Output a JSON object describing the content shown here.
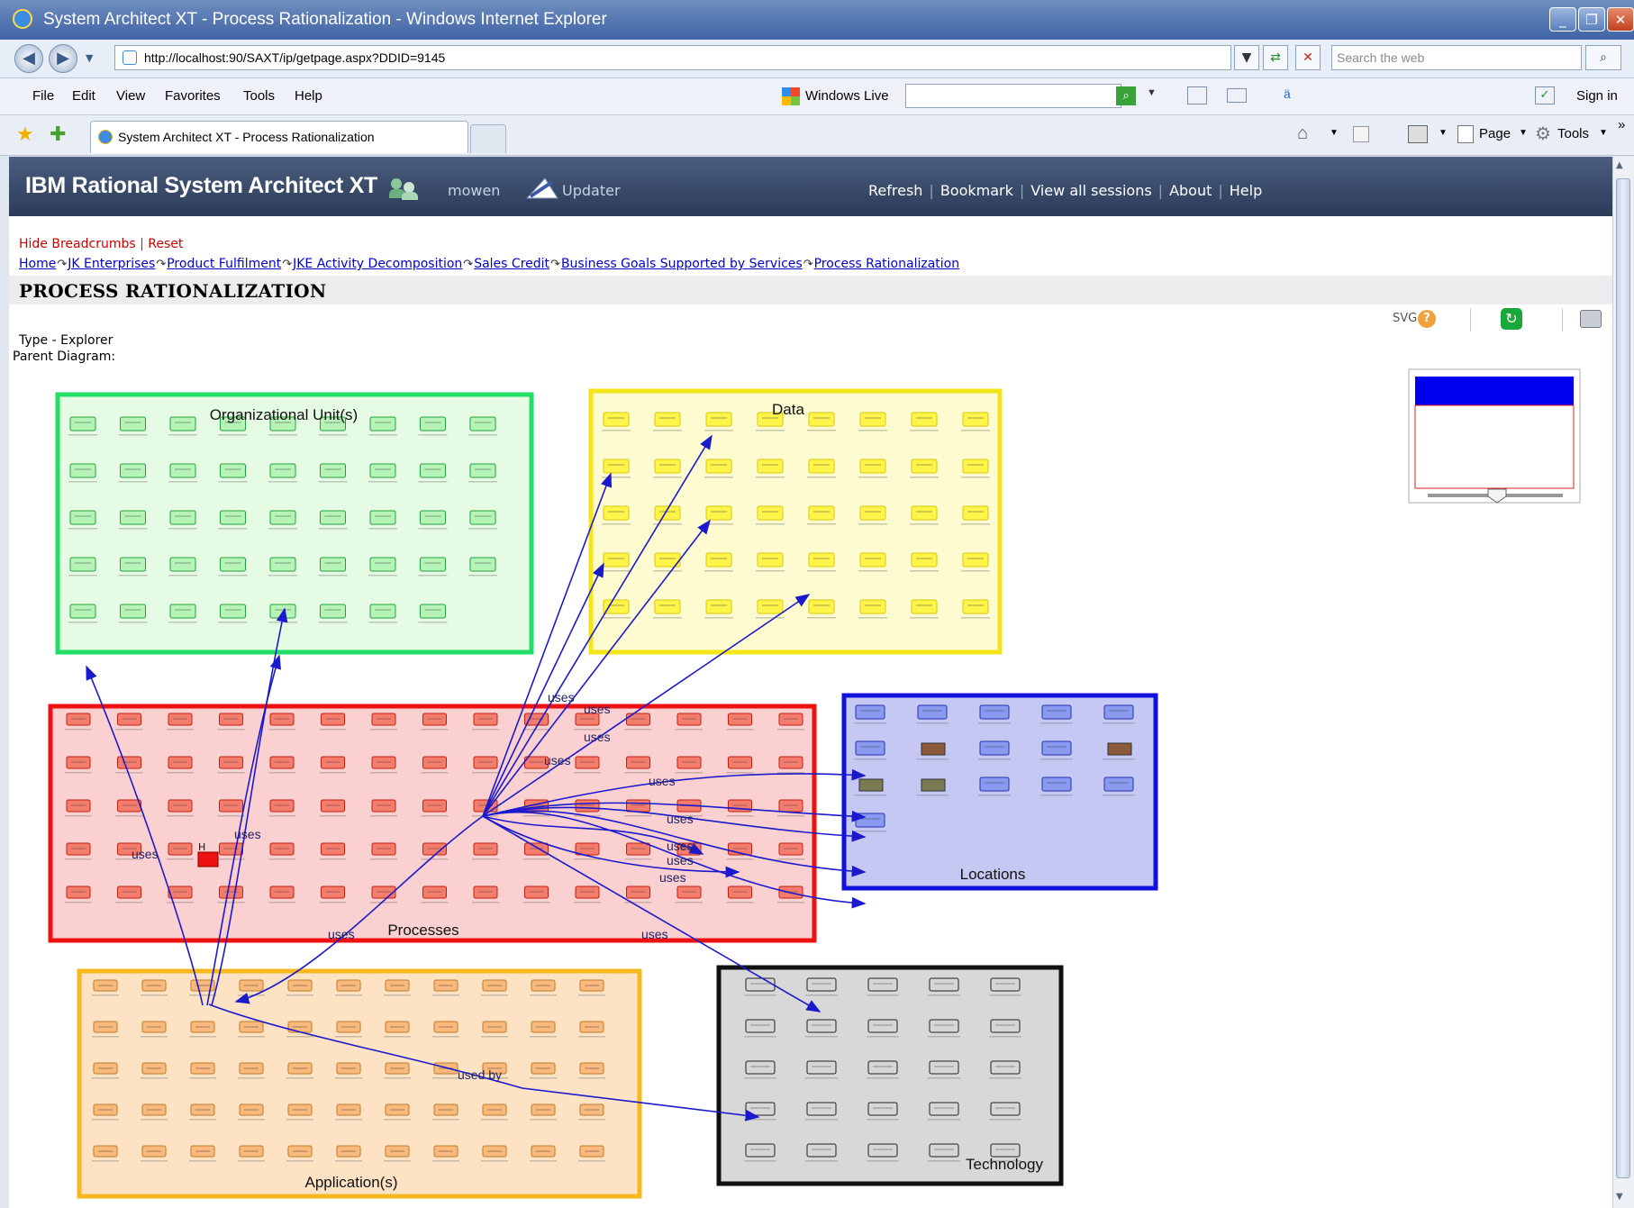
{
  "window": {
    "title": "System Architect XT - Process Rationalization - Windows Internet Explorer",
    "min_glyph": "_",
    "max_glyph": "❐",
    "close_glyph": "✕"
  },
  "address_bar": {
    "url": "http://localhost:90/SAXT/ip/getpage.aspx?DDID=9145",
    "search_placeholder": "Search the web"
  },
  "menu": {
    "items": [
      "File",
      "Edit",
      "View",
      "Favorites",
      "Tools",
      "Help"
    ],
    "windows_live": "Windows Live",
    "sign_in": "Sign in"
  },
  "favorites_bar": {
    "tab_title": "System Architect XT - Process Rationalization",
    "page_label": "Page",
    "tools_label": "Tools"
  },
  "app_header": {
    "brand": "IBM Rational System Architect XT",
    "user": "mowen",
    "updater": "Updater",
    "nav": [
      "Refresh",
      "Bookmark",
      "View all sessions",
      "About",
      "Help"
    ]
  },
  "crumb_controls": {
    "hide": "Hide Breadcrumbs",
    "reset": "Reset"
  },
  "breadcrumbs": [
    "Home",
    "JK Enterprises",
    "Product Fulfilment",
    "JKE Activity Decomposition",
    "Sales Credit",
    "Business Goals Supported by Services",
    "Process Rationalization"
  ],
  "page_title": "PROCESS RATIONALIZATION",
  "toolbar": {
    "svg_label": "SVG"
  },
  "meta": {
    "type_line": "Type - Explorer",
    "parent_line": "Parent Diagram:"
  },
  "diagram": {
    "groups": {
      "org": {
        "label": "Organizational Unit(s)",
        "stroke": "#22dd66",
        "fill": "#e6fbe4",
        "node_fill": "#b6f3b6",
        "node_stroke": "#22a040"
      },
      "data": {
        "label": "Data",
        "stroke": "#f4e41a",
        "fill": "#fdfbcf",
        "node_fill": "#fff44a",
        "node_stroke": "#d8c80a"
      },
      "processes": {
        "label": "Processes",
        "stroke": "#ee1111",
        "fill": "#fbd0d0",
        "node_fill": "#f47c6c",
        "node_stroke": "#c02010"
      },
      "locations": {
        "label": "Locations",
        "stroke": "#1111dd",
        "fill": "#c6c8f4",
        "node_fill": "#8a9af0",
        "node_stroke": "#2233aa"
      },
      "applications": {
        "label": "Application(s)",
        "stroke": "#f7b81f",
        "fill": "#fde3c4",
        "node_fill": "#f9b97c",
        "node_stroke": "#c07a2a"
      },
      "technology": {
        "label": "Technology",
        "stroke": "#111111",
        "fill": "#d8d8d8",
        "node_fill": "#d6d6d6",
        "node_stroke": "#222222"
      }
    },
    "relation_labels": {
      "uses": "uses",
      "used_by": "used by",
      "short_h": "H"
    },
    "connector_color": "#1a1acc",
    "overview_header_color": "#0000ee"
  }
}
